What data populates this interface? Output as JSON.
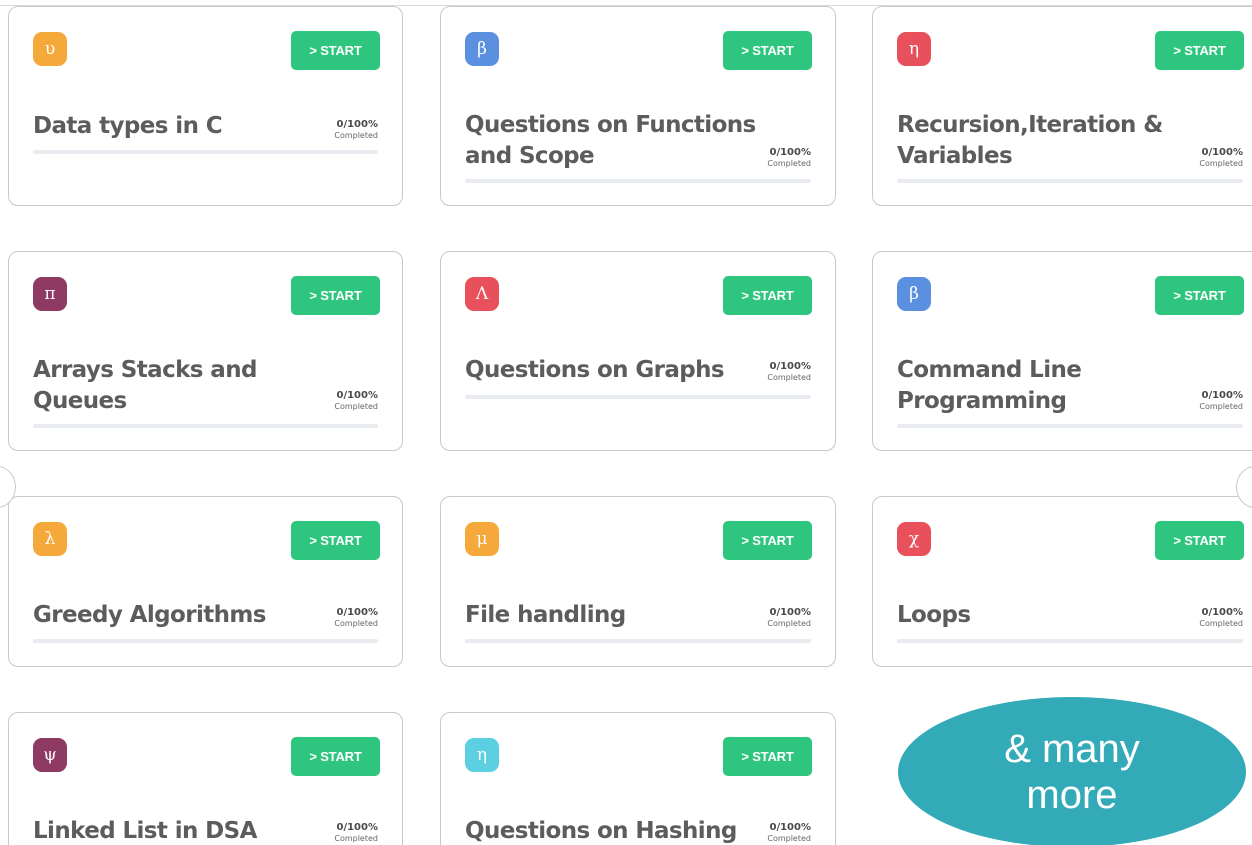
{
  "cards": [
    {
      "badge_symbol": "υ",
      "badge_color": "#f5a93a",
      "icon_name": "upsilon-icon",
      "start_label": "> START",
      "title_lines": [
        "Data types in C"
      ],
      "progress_text": "0/100%",
      "progress_label": "Completed",
      "progress": 0
    },
    {
      "badge_symbol": "β",
      "badge_color": "#5b8fe0",
      "icon_name": "beta-icon",
      "start_label": "> START",
      "title_lines": [
        "Questions on Functions",
        "and Scope"
      ],
      "progress_text": "0/100%",
      "progress_label": "Completed",
      "progress": 0
    },
    {
      "badge_symbol": "η",
      "badge_color": "#e8505b",
      "icon_name": "eta-icon",
      "start_label": "> START",
      "title_lines": [
        "Recursion,Iteration &",
        "Variables"
      ],
      "progress_text": "0/100%",
      "progress_label": "Completed",
      "progress": 0
    },
    {
      "badge_symbol": "π",
      "badge_color": "#8e3a63",
      "icon_name": "pi-icon",
      "start_label": "> START",
      "title_lines": [
        "Arrays Stacks and",
        "Queues"
      ],
      "progress_text": "0/100%",
      "progress_label": "Completed",
      "progress": 0
    },
    {
      "badge_symbol": "Λ",
      "badge_color": "#e8505b",
      "icon_name": "lambda-upper-icon",
      "start_label": "> START",
      "title_lines": [
        "Questions on Graphs"
      ],
      "progress_text": "0/100%",
      "progress_label": "Completed",
      "progress": 0
    },
    {
      "badge_symbol": "β",
      "badge_color": "#5b8fe0",
      "icon_name": "beta-icon",
      "start_label": "> START",
      "title_lines": [
        "Command Line",
        "Programming"
      ],
      "progress_text": "0/100%",
      "progress_label": "Completed",
      "progress": 0
    },
    {
      "badge_symbol": "λ",
      "badge_color": "#f5a93a",
      "icon_name": "lambda-icon",
      "start_label": "> START",
      "title_lines": [
        "Greedy Algorithms"
      ],
      "progress_text": "0/100%",
      "progress_label": "Completed",
      "progress": 0
    },
    {
      "badge_symbol": "μ",
      "badge_color": "#f5a93a",
      "icon_name": "mu-icon",
      "start_label": "> START",
      "title_lines": [
        "File handling"
      ],
      "progress_text": "0/100%",
      "progress_label": "Completed",
      "progress": 0
    },
    {
      "badge_symbol": "χ",
      "badge_color": "#e8505b",
      "icon_name": "chi-icon",
      "start_label": "> START",
      "title_lines": [
        "Loops"
      ],
      "progress_text": "0/100%",
      "progress_label": "Completed",
      "progress": 0
    },
    {
      "badge_symbol": "ψ",
      "badge_color": "#8e3a63",
      "icon_name": "psi-icon",
      "start_label": "> START",
      "title_lines": [
        "Linked List in DSA"
      ],
      "progress_text": "0/100%",
      "progress_label": "Completed",
      "progress": 0
    },
    {
      "badge_symbol": "η",
      "badge_color": "#5ccfe0",
      "icon_name": "eta-icon",
      "start_label": "> START",
      "title_lines": [
        "Questions on Hashing"
      ],
      "progress_text": "0/100%",
      "progress_label": "Completed",
      "progress": 0
    }
  ],
  "more_bubble": {
    "text": "& many more",
    "color": "#32aab8"
  },
  "accent_color": "#2ec67f"
}
